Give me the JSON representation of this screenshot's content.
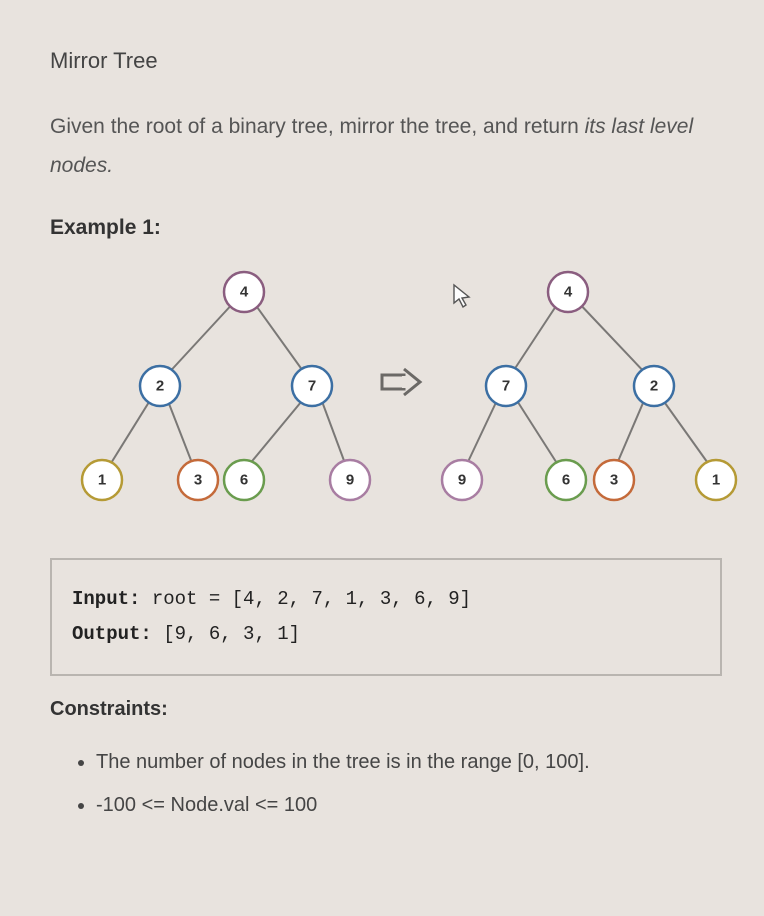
{
  "title": "Mirror Tree",
  "description_parts": {
    "p1": "Given the root of a binary tree, mirror the tree, and return ",
    "em": "its last level nodes.",
    "p2": ""
  },
  "example_label": "Example 1:",
  "diagram": {
    "left_tree": {
      "root": "4",
      "l": "2",
      "r": "7",
      "ll": "1",
      "lr": "3",
      "rl": "6",
      "rr": "9"
    },
    "right_tree": {
      "root": "4",
      "l": "7",
      "r": "2",
      "ll": "9",
      "lr": "6",
      "rl": "3",
      "rr": "1"
    }
  },
  "code": {
    "input_label": "Input:",
    "input_rest": " root = [4, 2, 7, 1, 3, 6, 9]",
    "output_label": "Output:",
    "output_rest": " [9, 6, 3, 1]"
  },
  "constraints_label": "Constraints:",
  "constraints": [
    "The number of nodes in the tree is in the range [0, 100].",
    "-100 <= Node.val <= 100"
  ]
}
